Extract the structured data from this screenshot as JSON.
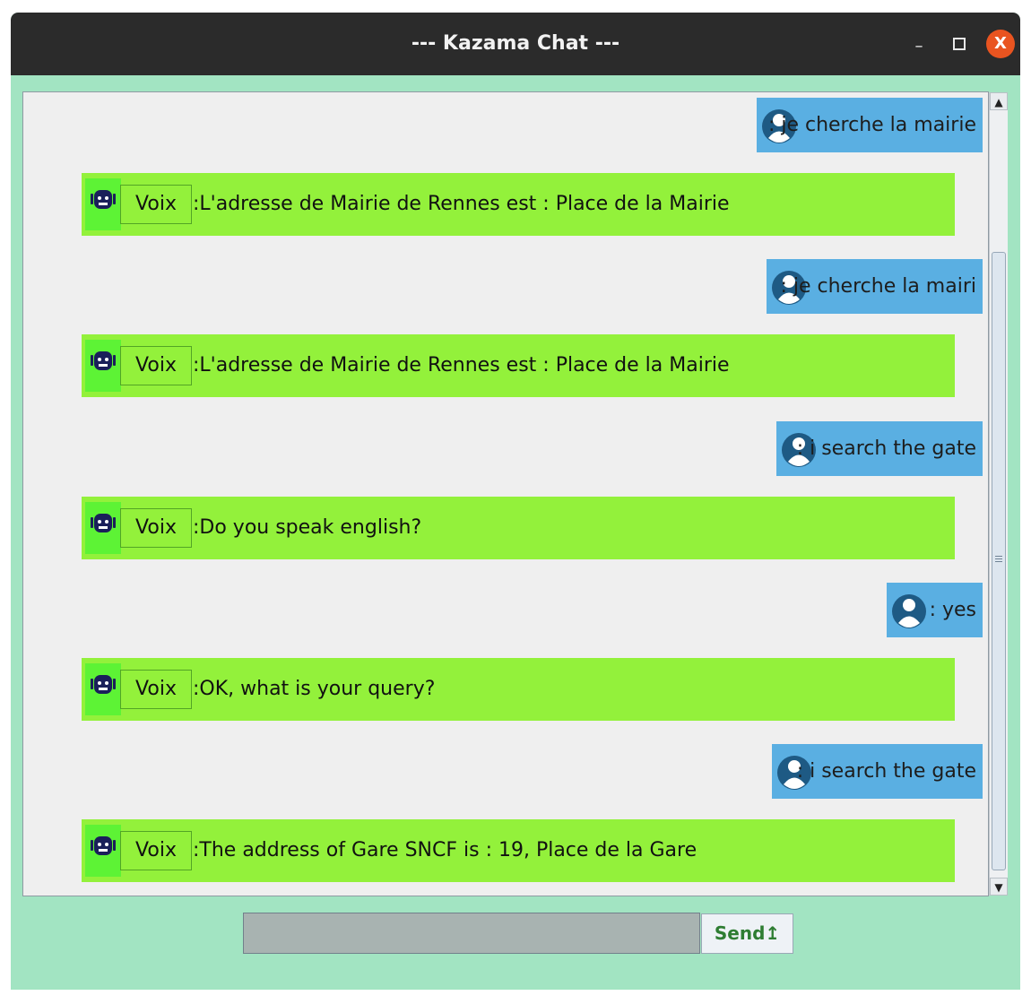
{
  "window": {
    "title": "--- Kazama Chat ---",
    "minimize_label": "–",
    "close_label": "X"
  },
  "chat": {
    "messages": [
      {
        "sender": "user",
        "text": ": je cherche la mairie"
      },
      {
        "sender": "bot",
        "name": "Voix",
        "text": ":L'adresse de Mairie de Rennes est : Place de la Mairie"
      },
      {
        "sender": "user",
        "text": ": je cherche la mairi"
      },
      {
        "sender": "bot",
        "name": "Voix",
        "text": ":L'adresse de Mairie de Rennes est : Place de la Mairie"
      },
      {
        "sender": "user",
        "text": ": i search the gate"
      },
      {
        "sender": "bot",
        "name": "Voix",
        "text": ":Do you speak english?"
      },
      {
        "sender": "user",
        "text": ": yes"
      },
      {
        "sender": "bot",
        "name": "Voix",
        "text": ":OK, what is your query?"
      },
      {
        "sender": "user",
        "text": ": i search the gate"
      },
      {
        "sender": "bot",
        "name": "Voix",
        "text": ":The address of Gare SNCF is : 19, Place de la Gare"
      }
    ]
  },
  "input": {
    "value": "",
    "send_label": "Send↥"
  },
  "colors": {
    "window_bg": "#a2e4c2",
    "user_bubble": "#5aafe2",
    "bot_bubble": "#93f13b",
    "titlebar": "#2b2b2b",
    "close_button": "#e95420"
  }
}
